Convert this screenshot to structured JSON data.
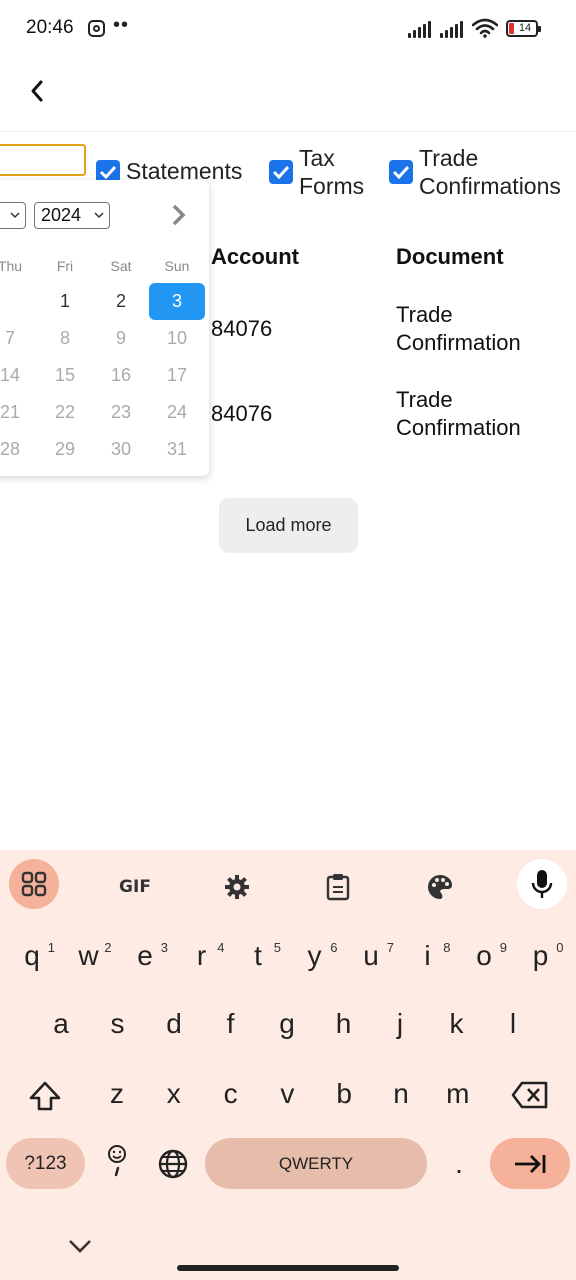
{
  "status_bar": {
    "time": "20:46",
    "dots": "••",
    "battery": "14"
  },
  "header": {
    "back_icon": "chevron-left-icon"
  },
  "filters": {
    "checkboxes": [
      {
        "label": "Statements",
        "checked": true
      },
      {
        "label": "Tax\nForms",
        "checked": true
      },
      {
        "label": "Trade\nConfirmations",
        "checked": true
      }
    ]
  },
  "table": {
    "headers": [
      "Account",
      "Document"
    ],
    "rows": [
      {
        "account": "84076",
        "document": "Trade\nConfirmation"
      },
      {
        "account": "84076",
        "document": "Trade\nConfirmation"
      }
    ]
  },
  "load_more_label": "Load more",
  "calendar": {
    "year": "2024",
    "weekdays": [
      "Thu",
      "Fri",
      "Sat",
      "Sun"
    ],
    "weeks": [
      [
        "",
        "1",
        "2",
        "3"
      ],
      [
        "7",
        "8",
        "9",
        "10"
      ],
      [
        "14",
        "15",
        "16",
        "17"
      ],
      [
        "21",
        "22",
        "23",
        "24"
      ],
      [
        "28",
        "29",
        "30",
        "31"
      ]
    ],
    "selected_day": "3",
    "accent_color": "#2196f3"
  },
  "keyboard": {
    "row1": [
      {
        "key": "q",
        "hint": "1"
      },
      {
        "key": "w",
        "hint": "2"
      },
      {
        "key": "e",
        "hint": "3"
      },
      {
        "key": "r",
        "hint": "4"
      },
      {
        "key": "t",
        "hint": "5"
      },
      {
        "key": "y",
        "hint": "6"
      },
      {
        "key": "u",
        "hint": "7"
      },
      {
        "key": "i",
        "hint": "8"
      },
      {
        "key": "o",
        "hint": "9"
      },
      {
        "key": "p",
        "hint": "0"
      }
    ],
    "row2": [
      "a",
      "s",
      "d",
      "f",
      "g",
      "h",
      "j",
      "k",
      "l"
    ],
    "row3": [
      "z",
      "x",
      "c",
      "v",
      "b",
      "n",
      "m"
    ],
    "symbols_label": "?123",
    "space_label": "QWERTY",
    "period_label": ".",
    "toolbar": {
      "gif_label": "GIF",
      "icons": [
        "apps-grid-icon",
        "gif-icon",
        "settings-gear-icon",
        "clipboard-icon",
        "palette-icon",
        "microphone-icon"
      ]
    },
    "bg_color": "#fdebe4",
    "accent_color": "#f6b19b"
  }
}
